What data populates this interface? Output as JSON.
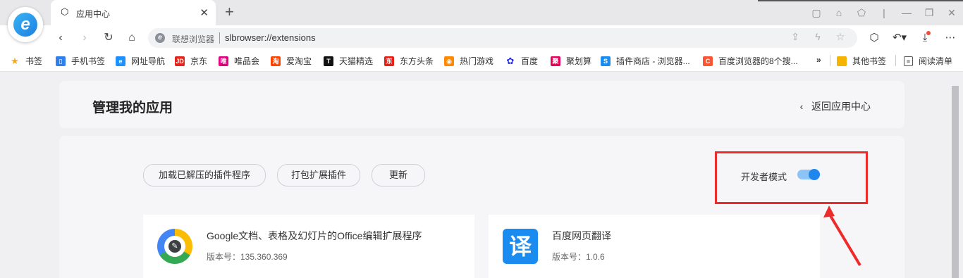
{
  "tab": {
    "title": "应用中心",
    "icon": "extension-icon"
  },
  "address": {
    "site_name": "联想浏览器",
    "url": "slbrowser://extensions"
  },
  "bookmarks": {
    "items": [
      {
        "label": "书签",
        "icon": "star-icon",
        "color": "#f5a623"
      },
      {
        "label": "手机书签",
        "icon": "phone-icon",
        "color": "#2f80ed"
      },
      {
        "label": "网址导航",
        "icon": "browser-e-icon",
        "color": "#1e90ff"
      },
      {
        "label": "京东",
        "icon": "jd-logo-icon",
        "color": "#e1251b"
      },
      {
        "label": "唯品会",
        "icon": "vip-logo-icon",
        "color": "#e5007f"
      },
      {
        "label": "爱淘宝",
        "icon": "taobao-logo-icon",
        "color": "#ff4400"
      },
      {
        "label": "天猫精选",
        "icon": "tmall-logo-icon",
        "color": "#111111"
      },
      {
        "label": "东方头条",
        "icon": "dftt-logo-icon",
        "color": "#e62117"
      },
      {
        "label": "热门游戏",
        "icon": "game-icon",
        "color": "#ff8a00"
      },
      {
        "label": "百度",
        "icon": "baidu-paw-icon",
        "color": "#2932e1"
      },
      {
        "label": "聚划算",
        "icon": "juhuasuan-logo-icon",
        "color": "#e8005a"
      },
      {
        "label": "插件商店 - 浏览器...",
        "icon": "plugin-store-icon",
        "color": "#1a8cf0"
      },
      {
        "label": "百度浏览器的8个搜...",
        "icon": "csdn-c-icon",
        "color": "#fc5531"
      }
    ],
    "overflow": "»",
    "other": "其他书签",
    "reading": "阅读清单"
  },
  "page": {
    "title": "管理我的应用",
    "back": "返回应用中心",
    "buttons": [
      "加载已解压的插件程序",
      "打包扩展插件",
      "更新"
    ],
    "dev_mode_label": "开发者模式",
    "dev_mode_on": true
  },
  "extensions": [
    {
      "name": "Google文档、表格及幻灯片的Office编辑扩展程序",
      "version": "版本号：135.360.369",
      "icon": "google-docs-editor-icon"
    },
    {
      "name": "百度网页翻译",
      "version": "版本号：1.0.6",
      "icon_text": "译",
      "icon": "baidu-translate-icon"
    }
  ],
  "colors": {
    "accent": "#1f86ee",
    "highlight": "#ee2b2b"
  }
}
